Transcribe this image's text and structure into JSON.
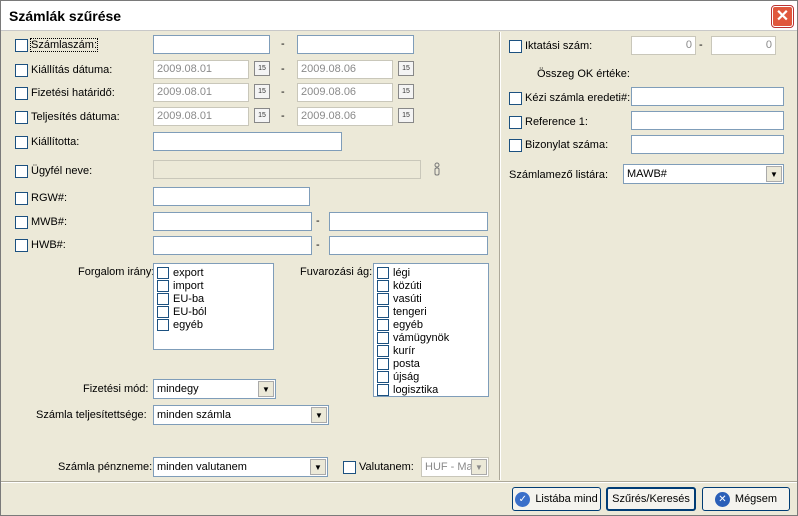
{
  "window": {
    "title": "Számlák szűrése",
    "close_glyph": "✕"
  },
  "left": {
    "szamlaszam": {
      "label": "Számlaszám:",
      "from": "",
      "to": ""
    },
    "kiallitas": {
      "label": "Kiállítás dátuma:",
      "from": "2009.08.01",
      "to": "2009.08.06"
    },
    "fizetesi": {
      "label": "Fizetési határidő:",
      "from": "2009.08.01",
      "to": "2009.08.06"
    },
    "teljesites": {
      "label": "Teljesítés dátuma:",
      "from": "2009.08.01",
      "to": "2009.08.06"
    },
    "kiallitotta": {
      "label": "Kiállította:",
      "value": ""
    },
    "ugyfel": {
      "label": "Ügyfél neve:",
      "value": ""
    },
    "rgw": {
      "label": "RGW#:",
      "value": ""
    },
    "mwb": {
      "label": "MWB#:",
      "from": "",
      "to": ""
    },
    "hwb": {
      "label": "HWB#:",
      "from": "",
      "to": ""
    },
    "dash": "-",
    "cal_glyph": "15",
    "forgalom": {
      "label": "Forgalom irány:",
      "items": [
        "export",
        "import",
        "EU-ba",
        "EU-ból",
        "egyéb"
      ]
    },
    "fuvarozasi": {
      "label": "Fuvarozási ág:",
      "items": [
        "légi",
        "közúti",
        "vasúti",
        "tengeri",
        "egyéb",
        "vámügynök",
        "kurír",
        "posta",
        "újság",
        "logisztika"
      ]
    },
    "fizetesi_mod": {
      "label": "Fizetési mód:",
      "value": "mindegy"
    },
    "teljesitettseg": {
      "label": "Számla teljesítettsége:",
      "value": "minden számla"
    },
    "penznem": {
      "label": "Számla pénzneme:",
      "value": "minden valutanem"
    },
    "valutanem": {
      "label": "Valutanem:",
      "value": "HUF - Ma"
    },
    "arrow": "▼"
  },
  "right": {
    "iktatasi": {
      "label": "Iktatási szám:",
      "from": "0",
      "to": "0"
    },
    "osszeg_ok": "Összeg OK értéke:",
    "kezi": {
      "label": "Kézi számla eredeti#:",
      "value": ""
    },
    "reference": {
      "label": "Reference 1:",
      "value": ""
    },
    "bizonylat": {
      "label": "Bizonylat száma:",
      "value": ""
    },
    "szamlazo": {
      "label": "Számlamező listára:",
      "value": "MAWB#"
    }
  },
  "buttons": {
    "listaba": "Listába mind",
    "szures": "Szűrés/Keresés",
    "megsem": "Mégsem",
    "ok_glyph": "✓",
    "cancel_glyph": "✕"
  }
}
